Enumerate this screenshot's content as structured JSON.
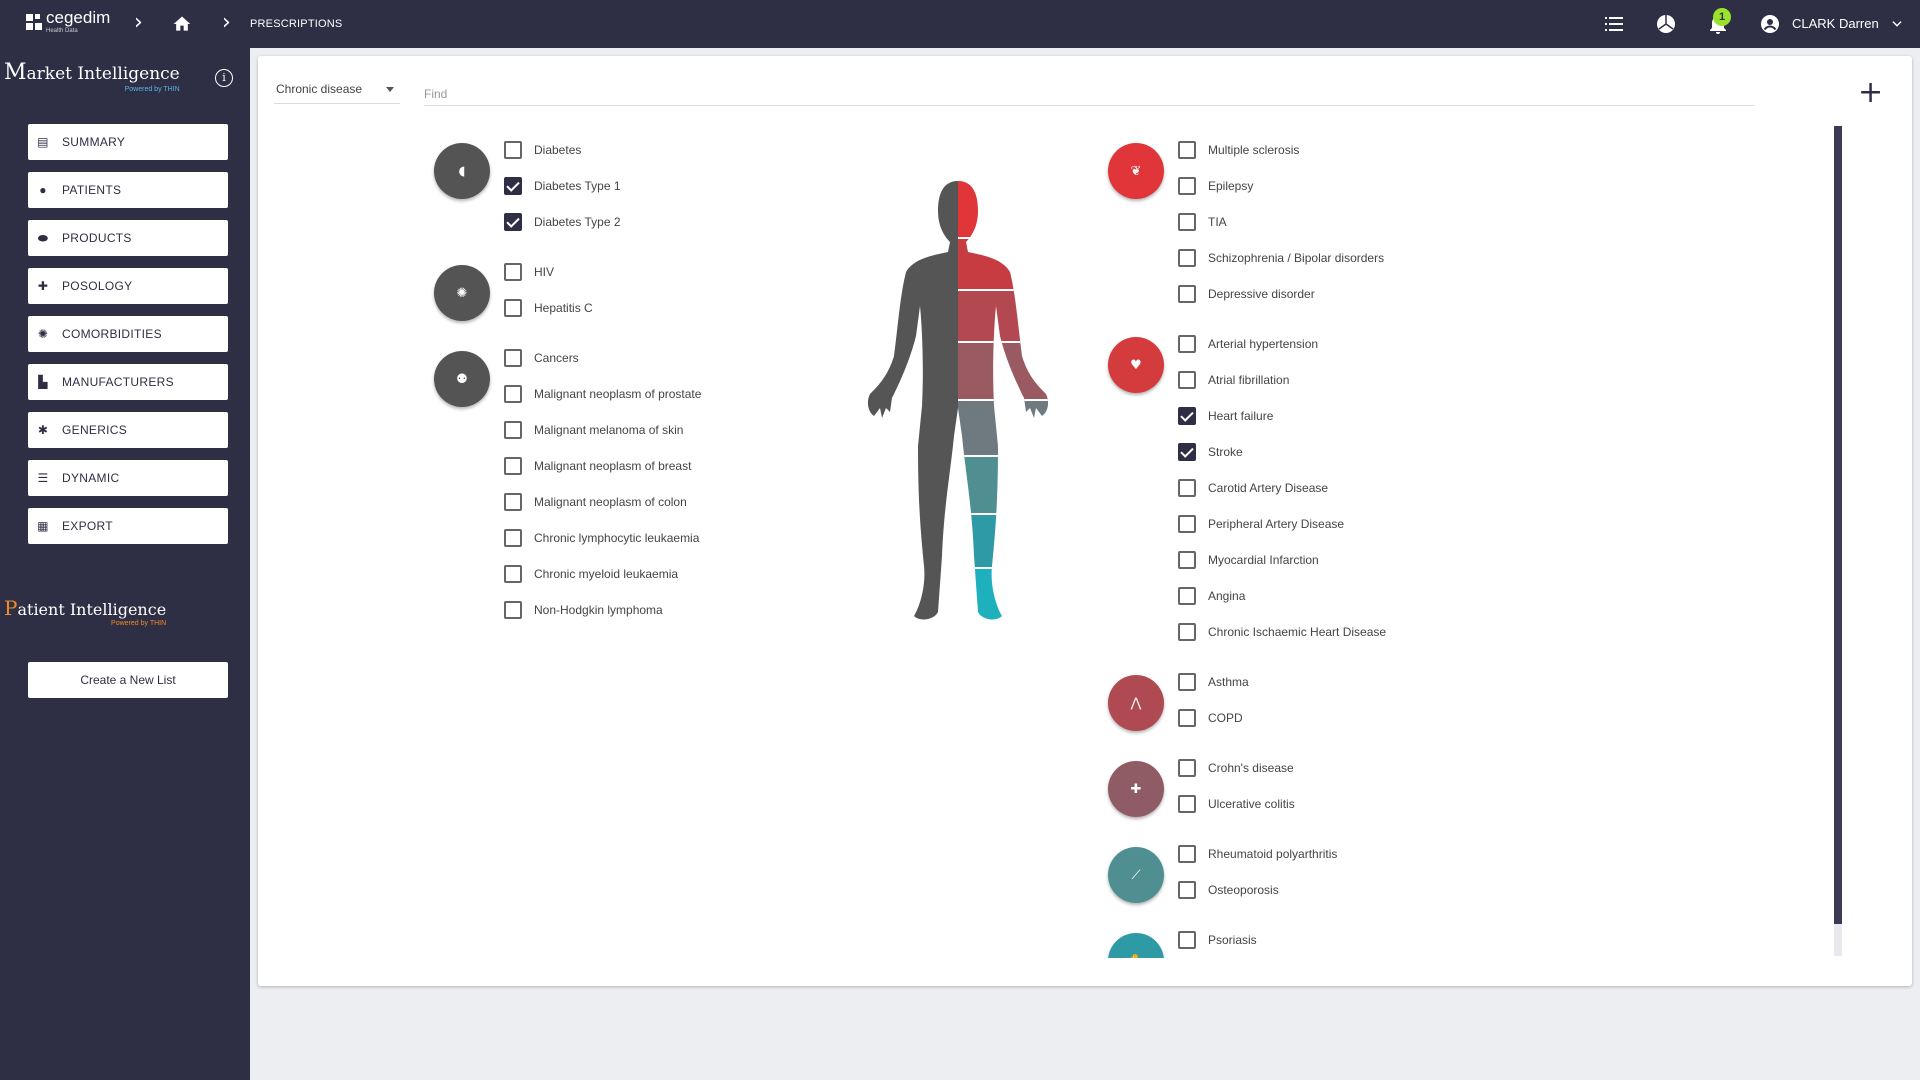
{
  "header": {
    "logo_text": "cegedim",
    "logo_sub": "Health Data",
    "breadcrumb": "PRESCRIPTIONS",
    "notifications_count": "1",
    "user_name": "CLARK Darren"
  },
  "sidebar": {
    "brand_first": "M",
    "brand_rest": "arket Intelligence",
    "brand_powered": "Powered by THIN",
    "items": [
      {
        "label": "SUMMARY",
        "icon": "document-icon"
      },
      {
        "label": "PATIENTS",
        "icon": "person-icon"
      },
      {
        "label": "PRODUCTS",
        "icon": "pills-icon"
      },
      {
        "label": "POSOLOGY",
        "icon": "medical-kit-icon"
      },
      {
        "label": "COMORBIDITIES",
        "icon": "virus-icon"
      },
      {
        "label": "MANUFACTURERS",
        "icon": "factory-icon"
      },
      {
        "label": "GENERICS",
        "icon": "asterisk-icon"
      },
      {
        "label": "DYNAMIC",
        "icon": "list-icon"
      },
      {
        "label": "EXPORT",
        "icon": "grid-icon"
      }
    ],
    "pi_first": "P",
    "pi_rest": "atient Intelligence",
    "pi_powered": "Powered by THIN",
    "create_label": "Create a New List"
  },
  "filter": {
    "dropdown_value": "Chronic disease",
    "find_placeholder": "Find",
    "add_label": "+"
  },
  "left_groups": [
    {
      "icon": "pancreas-icon",
      "color": "#545454",
      "items": [
        {
          "label": "Diabetes",
          "checked": false
        },
        {
          "label": "Diabetes Type 1",
          "checked": true
        },
        {
          "label": "Diabetes Type 2",
          "checked": true
        }
      ]
    },
    {
      "icon": "virus-icon",
      "color": "#545454",
      "items": [
        {
          "label": "HIV",
          "checked": false
        },
        {
          "label": "Hepatitis C",
          "checked": false
        }
      ]
    },
    {
      "icon": "cell-icon",
      "color": "#545454",
      "items": [
        {
          "label": "Cancers",
          "checked": false
        },
        {
          "label": "Malignant neoplasm of prostate",
          "checked": false
        },
        {
          "label": "Malignant melanoma of skin",
          "checked": false
        },
        {
          "label": "Malignant neoplasm of breast",
          "checked": false
        },
        {
          "label": "Malignant neoplasm of colon",
          "checked": false
        },
        {
          "label": "Chronic lymphocytic leukaemia",
          "checked": false
        },
        {
          "label": "Chronic myeloid leukaemia",
          "checked": false
        },
        {
          "label": "Non-Hodgkin lymphoma",
          "checked": false
        }
      ]
    }
  ],
  "right_groups": [
    {
      "icon": "brain-icon",
      "color": "#e0363a",
      "items": [
        {
          "label": "Multiple sclerosis",
          "checked": false
        },
        {
          "label": "Epilepsy",
          "checked": false
        },
        {
          "label": "TIA",
          "checked": false
        },
        {
          "label": "Schizophrenia / Bipolar disorders",
          "checked": false
        },
        {
          "label": "Depressive disorder",
          "checked": false
        }
      ]
    },
    {
      "icon": "heart-icon",
      "color": "#d43b3d",
      "items": [
        {
          "label": "Arterial hypertension",
          "checked": false
        },
        {
          "label": "Atrial fibrillation",
          "checked": false
        },
        {
          "label": "Heart failure",
          "checked": true
        },
        {
          "label": "Stroke",
          "checked": true
        },
        {
          "label": "Carotid Artery Disease",
          "checked": false
        },
        {
          "label": "Peripheral Artery Disease",
          "checked": false
        },
        {
          "label": "Myocardial Infarction",
          "checked": false
        },
        {
          "label": "Angina",
          "checked": false
        },
        {
          "label": "Chronic Ischaemic Heart Disease",
          "checked": false
        }
      ]
    },
    {
      "icon": "lungs-icon",
      "color": "#b04a52",
      "items": [
        {
          "label": "Asthma",
          "checked": false
        },
        {
          "label": "COPD",
          "checked": false
        }
      ]
    },
    {
      "icon": "intestine-icon",
      "color": "#8f5b64",
      "items": [
        {
          "label": "Crohn's disease",
          "checked": false
        },
        {
          "label": "Ulcerative colitis",
          "checked": false
        }
      ]
    },
    {
      "icon": "bone-icon",
      "color": "#4f8f92",
      "items": [
        {
          "label": "Rheumatoid polyarthritis",
          "checked": false
        },
        {
          "label": "Osteoporosis",
          "checked": false
        }
      ]
    },
    {
      "icon": "skin-icon",
      "color": "#2d9aa6",
      "items": [
        {
          "label": "Psoriasis",
          "checked": false
        }
      ]
    }
  ]
}
